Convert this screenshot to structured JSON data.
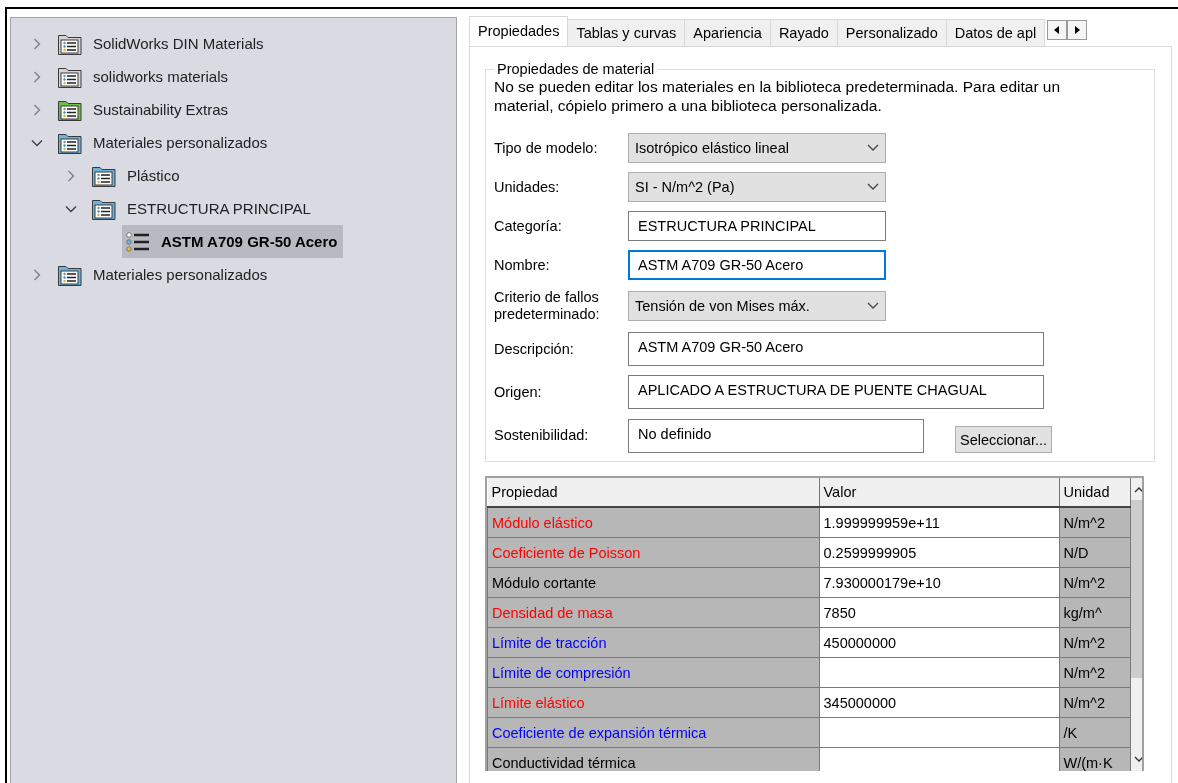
{
  "tree": [
    {
      "label": "SolidWorks DIN Materials",
      "kind": "library",
      "color": "#d4d4d4",
      "expanded": false,
      "selected": false
    },
    {
      "label": "solidworks materials",
      "kind": "library",
      "color": "#d4d4d4",
      "expanded": false,
      "selected": false
    },
    {
      "label": "Sustainability Extras",
      "kind": "library",
      "color": "#6cc04a",
      "expanded": false,
      "selected": false
    },
    {
      "label": "Materiales personalizados",
      "kind": "library",
      "color": "#6ab4e0",
      "expanded": true,
      "selected": false,
      "children": [
        {
          "label": "Plástico",
          "kind": "library",
          "color": "#6ab4e0",
          "expanded": false,
          "selected": false
        },
        {
          "label": "ESTRUCTURA PRINCIPAL",
          "kind": "library",
          "color": "#6ab4e0",
          "expanded": true,
          "selected": false,
          "children": [
            {
              "label": "ASTM A709 GR-50 Acero",
              "kind": "material",
              "selected": true
            }
          ]
        }
      ]
    },
    {
      "label": "Materiales personalizados",
      "kind": "library",
      "color": "#6ab4e0",
      "expanded": false,
      "selected": false
    }
  ],
  "tabs": [
    {
      "label": "Propiedades",
      "selected": true
    },
    {
      "label": "Tablas y curvas",
      "selected": false
    },
    {
      "label": "Apariencia",
      "selected": false
    },
    {
      "label": "Rayado",
      "selected": false
    },
    {
      "label": "Personalizado",
      "selected": false
    },
    {
      "label": "Datos de apl",
      "selected": false
    }
  ],
  "group": {
    "title": "Propiedades de material",
    "note": "No se pueden editar los materiales en la biblioteca predeterminada. Para editar un material, cópielo primero a una biblioteca personalizada."
  },
  "fields": [
    {
      "label": "Tipo de modelo:",
      "kind": "dropdown",
      "value": "Isotrópico elástico lineal"
    },
    {
      "label": "Unidades:",
      "kind": "dropdown",
      "value": "SI - N/m^2 (Pa)"
    },
    {
      "label": "Categoría:",
      "kind": "text",
      "value": "ESTRUCTURA PRINCIPAL"
    },
    {
      "label": "Nombre:",
      "kind": "text",
      "value": "ASTM A709 GR-50 Acero",
      "focused": true
    },
    {
      "label": "Criterio de fallos predeterminado:",
      "kind": "dropdown",
      "value": "Tensión de von Mises máx."
    },
    {
      "label": "Descripción:",
      "kind": "wide",
      "value": "ASTM A709 GR-50 Acero"
    },
    {
      "label": "Origen:",
      "kind": "wide",
      "value": "APLICADO A ESTRUCTURA DE PUENTE CHAGUAL"
    },
    {
      "label": "Sostenibilidad:",
      "kind": "select",
      "value": "No definido",
      "button": "Seleccionar..."
    }
  ],
  "table": {
    "columns": [
      "Propiedad",
      "Valor",
      "Unidad"
    ],
    "rows": [
      {
        "property": "Módulo elástico",
        "value": "1.999999959e+11",
        "unit": "N/m^2",
        "color": "#ff0000"
      },
      {
        "property": "Coeficiente de Poisson",
        "value": "0.2599999905",
        "unit": "N/D",
        "color": "#ff0000"
      },
      {
        "property": "Módulo cortante",
        "value": "7.930000179e+10",
        "unit": "N/m^2",
        "color": "#000000"
      },
      {
        "property": "Densidad de masa",
        "value": "7850",
        "unit": "kg/m^",
        "color": "#ff0000"
      },
      {
        "property": "Límite de tracción",
        "value": "450000000",
        "unit": "N/m^2",
        "color": "#0000ff"
      },
      {
        "property": "Límite de compresión",
        "unit": "N/m^2",
        "color": "#0000ff"
      },
      {
        "property": "Límite elástico",
        "value": "345000000",
        "unit": "N/m^2",
        "color": "#ff0000"
      },
      {
        "property": "Coeficiente de expansión térmica",
        "unit": "/K",
        "color": "#0000ff"
      },
      {
        "property": "Conductividad térmica",
        "unit": "W/(m·K",
        "color": "#000000"
      }
    ]
  }
}
